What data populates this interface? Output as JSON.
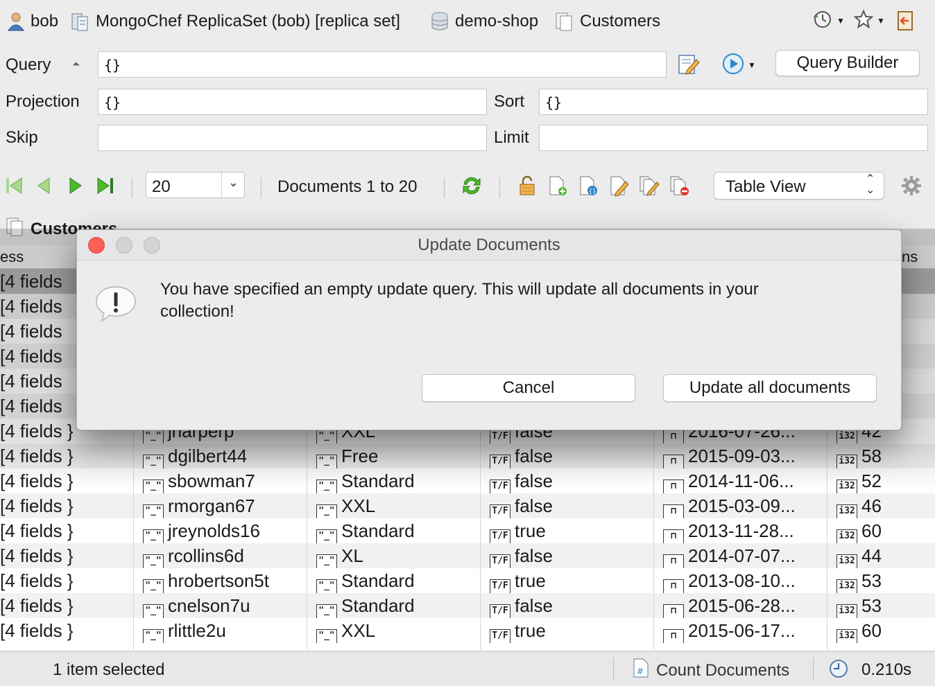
{
  "breadcrumb": {
    "user": "bob",
    "connection": "MongoChef ReplicaSet (bob) [replica set]",
    "database": "demo-shop",
    "collection": "Customers"
  },
  "query": {
    "query_label": "Query",
    "query_value": "{}",
    "projection_label": "Projection",
    "projection_value": "{}",
    "sort_label": "Sort",
    "sort_value": "{}",
    "skip_label": "Skip",
    "skip_value": "",
    "limit_label": "Limit",
    "limit_value": "",
    "query_builder_label": "Query Builder"
  },
  "toolbar": {
    "page_size": "20",
    "documents_range": "Documents 1 to 20",
    "view_mode": "Table View"
  },
  "collection_tab": {
    "title": "Customers"
  },
  "table": {
    "header_fragment_left": "ess",
    "header_fragment_right": "ns",
    "type_glyphs": {
      "string": "\"_\"",
      "bool": "T/F",
      "date": "⊓",
      "int": "i32"
    },
    "rows": [
      {
        "fields": "4 fields",
        "user": "",
        "plan": "",
        "flag": "",
        "date": "",
        "num": ""
      },
      {
        "fields": "4 fields",
        "user": "",
        "plan": "",
        "flag": "",
        "date": "",
        "num": ""
      },
      {
        "fields": "4 fields",
        "user": "",
        "plan": "",
        "flag": "",
        "date": "",
        "num": ""
      },
      {
        "fields": "4 fields",
        "user": "",
        "plan": "",
        "flag": "",
        "date": "",
        "num": ""
      },
      {
        "fields": "4 fields",
        "user": "",
        "plan": "",
        "flag": "",
        "date": "",
        "num": ""
      },
      {
        "fields": "4 fields",
        "user": "",
        "plan": "",
        "flag": "",
        "date": "",
        "num": ""
      },
      {
        "fields": "4 fields }",
        "user": "jharperp",
        "plan": "XXL",
        "flag": "false",
        "date": "2016-07-26...",
        "num": "42"
      },
      {
        "fields": "4 fields }",
        "user": "dgilbert44",
        "plan": "Free",
        "flag": "false",
        "date": "2015-09-03...",
        "num": "58"
      },
      {
        "fields": "4 fields }",
        "user": "sbowman7",
        "plan": "Standard",
        "flag": "false",
        "date": "2014-11-06...",
        "num": "52"
      },
      {
        "fields": "4 fields }",
        "user": "rmorgan67",
        "plan": "XXL",
        "flag": "false",
        "date": "2015-03-09...",
        "num": "46"
      },
      {
        "fields": "4 fields }",
        "user": "jreynolds16",
        "plan": "Standard",
        "flag": "true",
        "date": "2013-11-28...",
        "num": "60"
      },
      {
        "fields": "4 fields }",
        "user": "rcollins6d",
        "plan": "XL",
        "flag": "false",
        "date": "2014-07-07...",
        "num": "44"
      },
      {
        "fields": "4 fields }",
        "user": "hrobertson5t",
        "plan": "Standard",
        "flag": "true",
        "date": "2013-08-10...",
        "num": "53"
      },
      {
        "fields": "4 fields }",
        "user": "cnelson7u",
        "plan": "Standard",
        "flag": "false",
        "date": "2015-06-28...",
        "num": "53"
      },
      {
        "fields": "4 fields }",
        "user": "rlittle2u",
        "plan": "XXL",
        "flag": "true",
        "date": "2015-06-17...",
        "num": "60"
      }
    ]
  },
  "status": {
    "selection": "1 item selected",
    "count_documents": "Count Documents",
    "elapsed": "0.210s"
  },
  "dialog": {
    "title": "Update Documents",
    "message": "You have specified an empty update query. This will update all documents in your collection!",
    "cancel_label": "Cancel",
    "confirm_label": "Update all documents"
  },
  "colors": {
    "accent_green": "#3aa62a",
    "traffic_red": "#fc5f57",
    "selected_row": "#b9b9b9"
  }
}
